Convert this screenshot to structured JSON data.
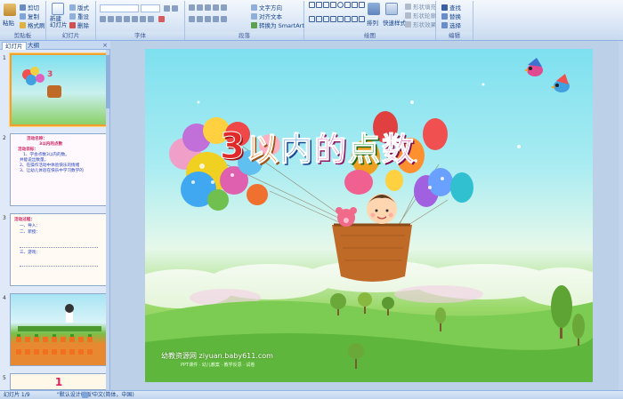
{
  "ribbon": {
    "clipboard": {
      "paste": "粘贴",
      "cut": "剪切",
      "copy": "复制",
      "format_painter": "格式刷",
      "label": "剪贴板"
    },
    "slides": {
      "new_slide": "新建\n幻灯片",
      "layout": "版式",
      "reset": "重设",
      "delete": "删除",
      "label": "幻灯片"
    },
    "font": {
      "label": "字体",
      "font_size": ""
    },
    "paragraph": {
      "label": "段落",
      "text_direction": "文字方向",
      "align_text": "对齐文本",
      "smartart": "转换为 SmartArt"
    },
    "drawing": {
      "label": "绘图",
      "arrange": "排列",
      "quick_styles": "快速样式",
      "shape_fill": "形状填充",
      "shape_outline": "形状轮廓",
      "shape_effects": "形状效果"
    },
    "editing": {
      "label": "编辑",
      "find": "查找",
      "replace": "替换",
      "select": "选择"
    }
  },
  "panel": {
    "tabs": [
      "幻灯片",
      "大纲"
    ],
    "close": "×",
    "thumbnails": [
      {
        "num": "1"
      },
      {
        "num": "2",
        "lines": [
          "活动名称：",
          "3以内的点数",
          "活动目标：",
          "1、学会点数3以内的数。",
          "并能说出数量。",
          "2、在操作活动中体验快乐的情绪",
          "3、让幼儿体验在快乐中学习数学的"
        ]
      },
      {
        "num": "3",
        "lines": [
          "活动过程：",
          "一、导入：",
          "二、新授：",
          "三、游戏："
        ]
      },
      {
        "num": "4"
      },
      {
        "num": "5",
        "digit": "1"
      }
    ]
  },
  "slide": {
    "title_chars": [
      "3",
      "以",
      "内",
      "的",
      "点",
      "数"
    ],
    "title_colors": [
      "#e02a2a",
      "#f07a1a",
      "#3a8ad0",
      "#e03aa8",
      "#3aa83a",
      "#d02a8a"
    ],
    "watermark": "幼教资源网 ziyuan.baby611.com",
    "watermark_sub": "PPT课件 · 幼儿教案 · 教学反思 · 试卷"
  },
  "status": {
    "slide_counter": "幻灯片 1/9",
    "theme": "\"默认设计模板\"",
    "language": "中文(简体，中国)"
  }
}
